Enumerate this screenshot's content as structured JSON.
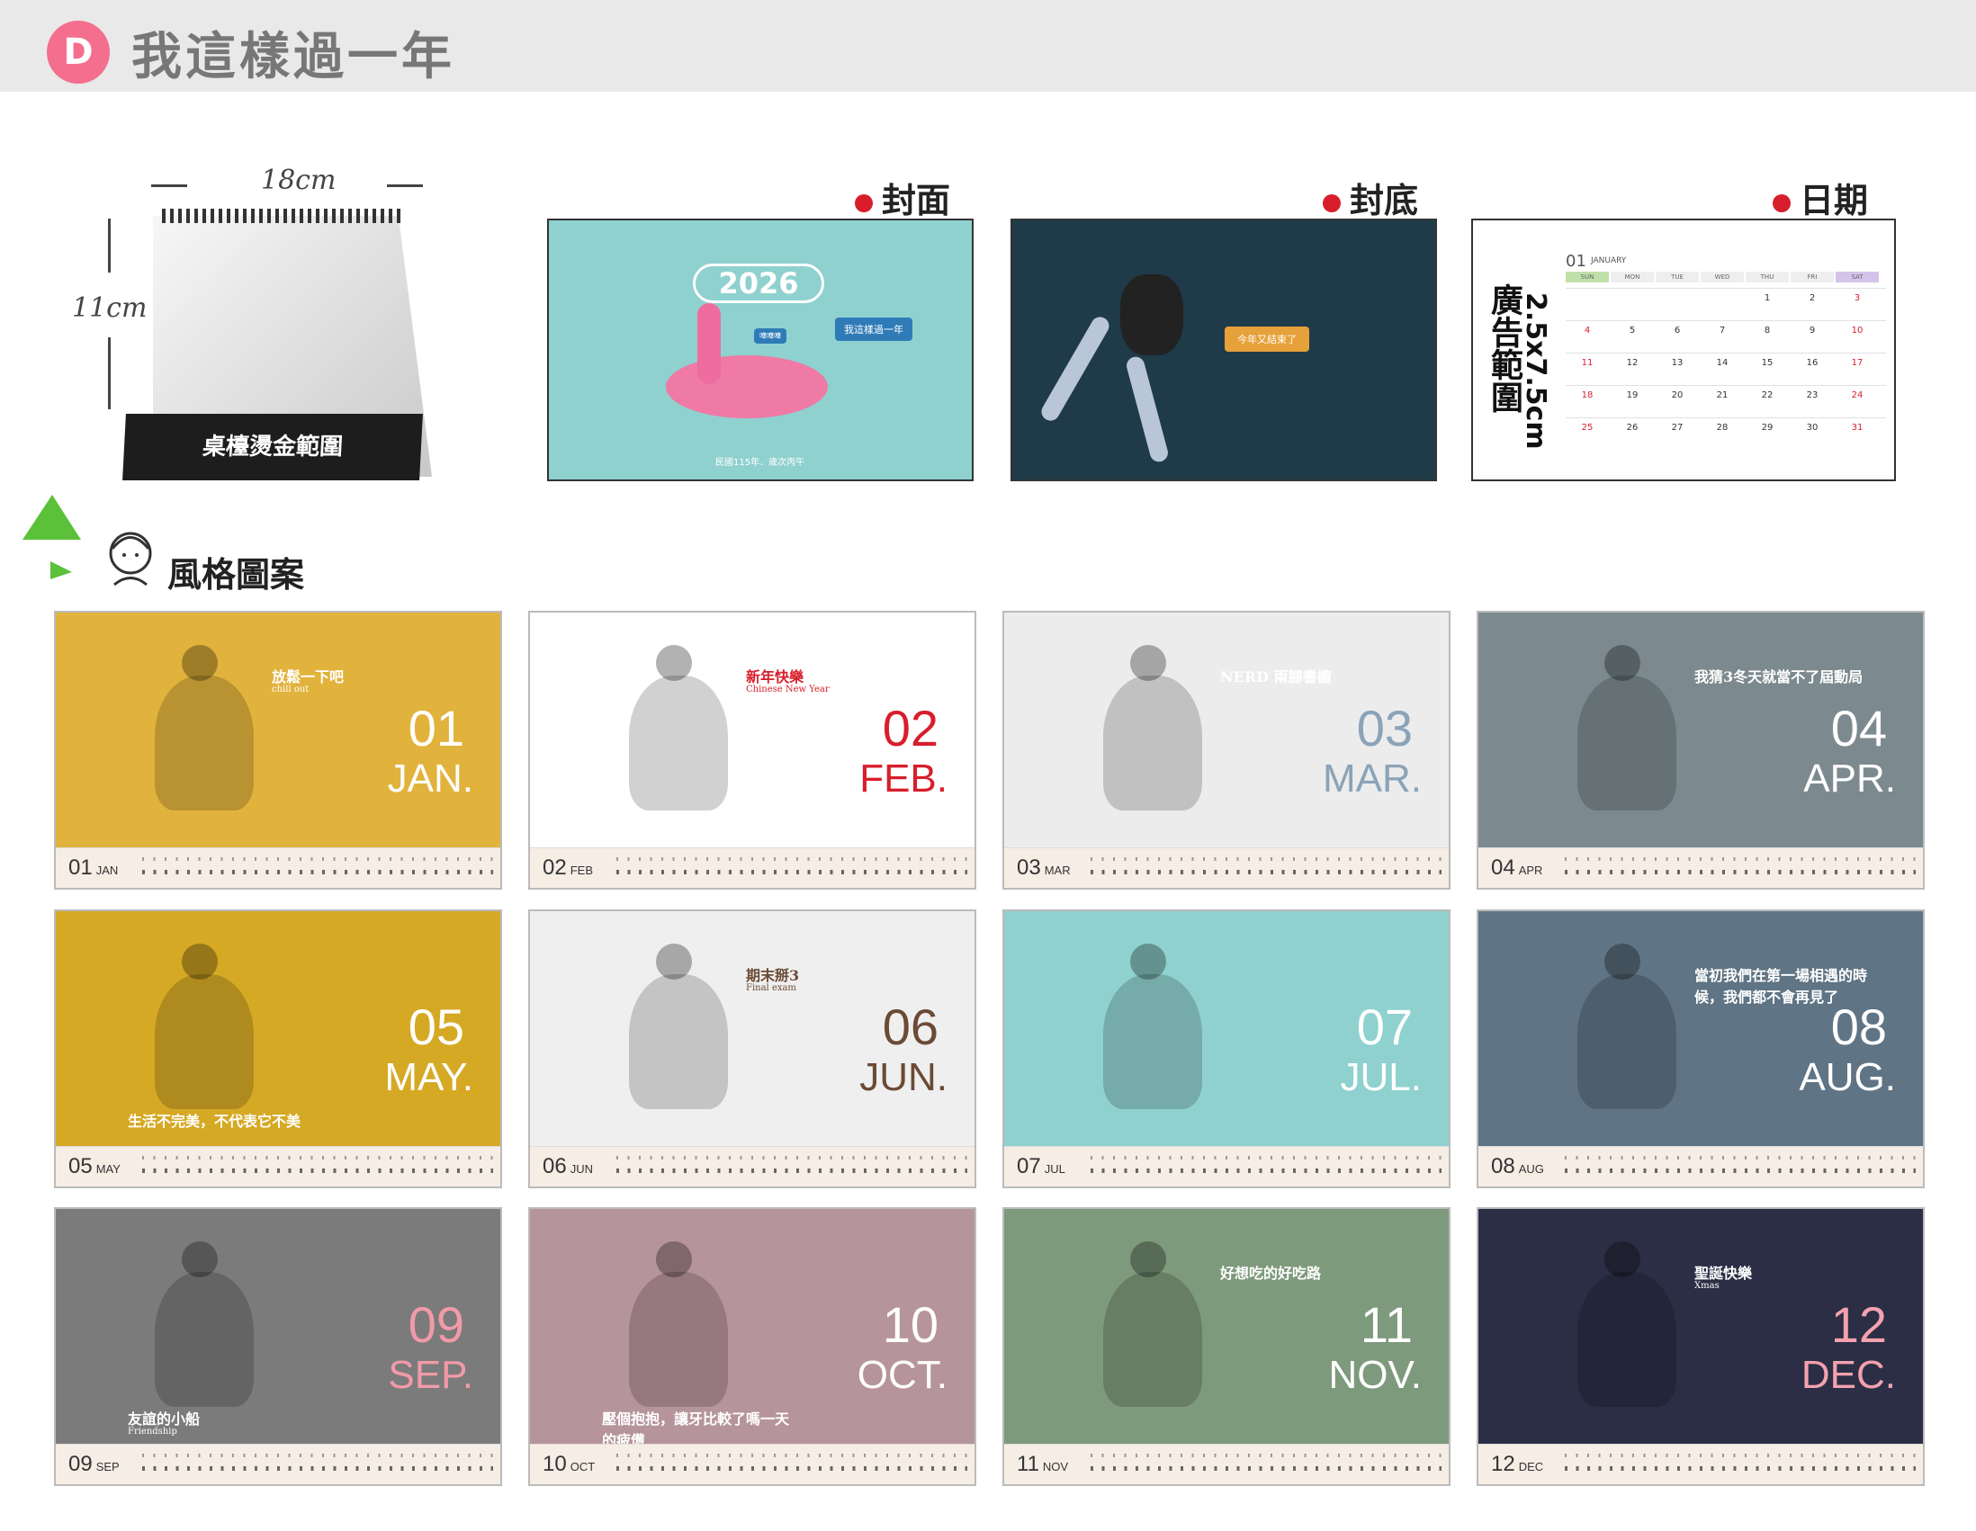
{
  "header": {
    "badge": "D",
    "title": "我這樣過一年"
  },
  "mockup": {
    "width_label": "18cm",
    "height_label": "11cm",
    "base_label": "桌檯燙金範圍"
  },
  "labels": {
    "cover": "封面",
    "back": "封底",
    "date": "日期"
  },
  "cover": {
    "year": "2026",
    "bubble": "我這樣過一年",
    "small": "民國115年．歲次丙午",
    "tag": "嘩嘩嘩"
  },
  "back": {
    "bubble": "今年又結束了"
  },
  "date_page": {
    "vertical_text_1": "廣告範圍",
    "vertical_text_2": "2.5x7.5cm",
    "month_num": "01",
    "month_name": "JANUARY",
    "days": [
      "SUN",
      "MON",
      "TUE",
      "WED",
      "THU",
      "FRI",
      "SAT"
    ],
    "rows": [
      [
        "",
        "",
        "",
        "",
        "1",
        "2",
        "3"
      ],
      [
        "4",
        "5",
        "6",
        "7",
        "8",
        "9",
        "10"
      ],
      [
        "11",
        "12",
        "13",
        "14",
        "15",
        "16",
        "17"
      ],
      [
        "18",
        "19",
        "20",
        "21",
        "22",
        "23",
        "24"
      ],
      [
        "25",
        "26",
        "27",
        "28",
        "29",
        "30",
        "31"
      ]
    ]
  },
  "style_section": {
    "title": "風格圖案"
  },
  "months": [
    {
      "num": "01",
      "name": "JAN.",
      "short": "JAN",
      "caption": "放鬆一下吧",
      "caption_sub": "chill out"
    },
    {
      "num": "02",
      "name": "FEB.",
      "short": "FEB",
      "caption": "新年快樂",
      "caption_sub": "Chinese New Year"
    },
    {
      "num": "03",
      "name": "MAR.",
      "short": "MAR",
      "caption": "NERD 兩腳書櫥",
      "caption_sub": ""
    },
    {
      "num": "04",
      "name": "APR.",
      "short": "APR",
      "caption": "我猜3冬天就當不了屆動局",
      "caption_sub": ""
    },
    {
      "num": "05",
      "name": "MAY.",
      "short": "MAY",
      "caption": "生活不完美，不代表它不美",
      "caption_sub": ""
    },
    {
      "num": "06",
      "name": "JUN.",
      "short": "JUN",
      "caption": "期末掰3",
      "caption_sub": "Final exam"
    },
    {
      "num": "07",
      "name": "JUL.",
      "short": "JUL",
      "caption": "",
      "caption_sub": ""
    },
    {
      "num": "08",
      "name": "AUG.",
      "short": "AUG",
      "caption": "當初我們在第一場相遇的時候，我們都不會再見了",
      "caption_sub": ""
    },
    {
      "num": "09",
      "name": "SEP.",
      "short": "SEP",
      "caption": "友誼的小船",
      "caption_sub": "Friendship"
    },
    {
      "num": "10",
      "name": "OCT.",
      "short": "OCT",
      "caption": "壓個抱抱，讓牙比較了嗎一天的疲憊",
      "caption_sub": ""
    },
    {
      "num": "11",
      "name": "NOV.",
      "short": "NOV",
      "caption": "好想吃的好吃路",
      "caption_sub": ""
    },
    {
      "num": "12",
      "name": "DEC.",
      "short": "DEC",
      "caption": "聖誕快樂",
      "caption_sub": "Xmas"
    }
  ],
  "colors": {
    "badge": "#f36f8d",
    "cards": [
      "#e2b33c",
      "#ffffff",
      "#ececec",
      "#7c8a8f",
      "#d6a925",
      "#efefef",
      "#8fd1cf",
      "#5f7484",
      "#7b7b7b",
      "#b6949c",
      "#7e9a7c",
      "#2b2e45"
    ],
    "num_colors": [
      "#ffffff",
      "#d81e2c",
      "#8aa3b8",
      "#ffffff",
      "#ffffff",
      "#6b4a36",
      "#ffffff",
      "#ffffff",
      "#f29aa8",
      "#ffffff",
      "#ffffff",
      "#f4a1ae"
    ]
  }
}
